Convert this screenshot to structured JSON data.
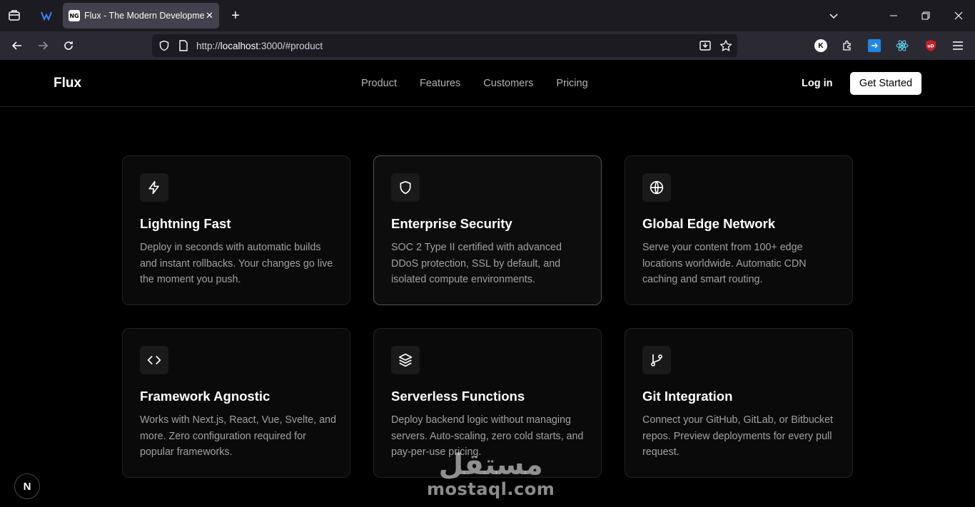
{
  "browser": {
    "tab_title": "Flux - The Modern Development Platform",
    "tab_favicon_text": "NG",
    "url_protocol": "http://",
    "url_host": "localhost",
    "url_rest": ":3000/#product",
    "extension_k": "K",
    "extension_ub": "uD"
  },
  "site": {
    "brand": "Flux",
    "nav": [
      "Product",
      "Features",
      "Customers",
      "Pricing"
    ],
    "login_label": "Log in",
    "cta_label": "Get Started"
  },
  "features": [
    {
      "icon": "lightning-icon",
      "title": "Lightning Fast",
      "desc": "Deploy in seconds with automatic builds and instant rollbacks. Your changes go live the moment you push."
    },
    {
      "icon": "shield-icon",
      "title": "Enterprise Security",
      "desc": "SOC 2 Type II certified with advanced DDoS protection, SSL by default, and isolated compute environments."
    },
    {
      "icon": "globe-icon",
      "title": "Global Edge Network",
      "desc": "Serve your content from 100+ edge locations worldwide. Automatic CDN caching and smart routing."
    },
    {
      "icon": "code-icon",
      "title": "Framework Agnostic",
      "desc": "Works with Next.js, React, Vue, Svelte, and more. Zero configuration required for popular frameworks."
    },
    {
      "icon": "layers-icon",
      "title": "Serverless Functions",
      "desc": "Deploy backend logic without managing servers. Auto-scaling, zero cold starts, and pay-per-use pricing."
    },
    {
      "icon": "git-branch-icon",
      "title": "Git Integration",
      "desc": "Connect your GitHub, GitLab, or Bitbucket repos. Preview deployments for every pull request."
    }
  ],
  "nextjs_badge": "N",
  "watermark": {
    "arabic": "مستقل",
    "latin": "mostaql.com"
  }
}
